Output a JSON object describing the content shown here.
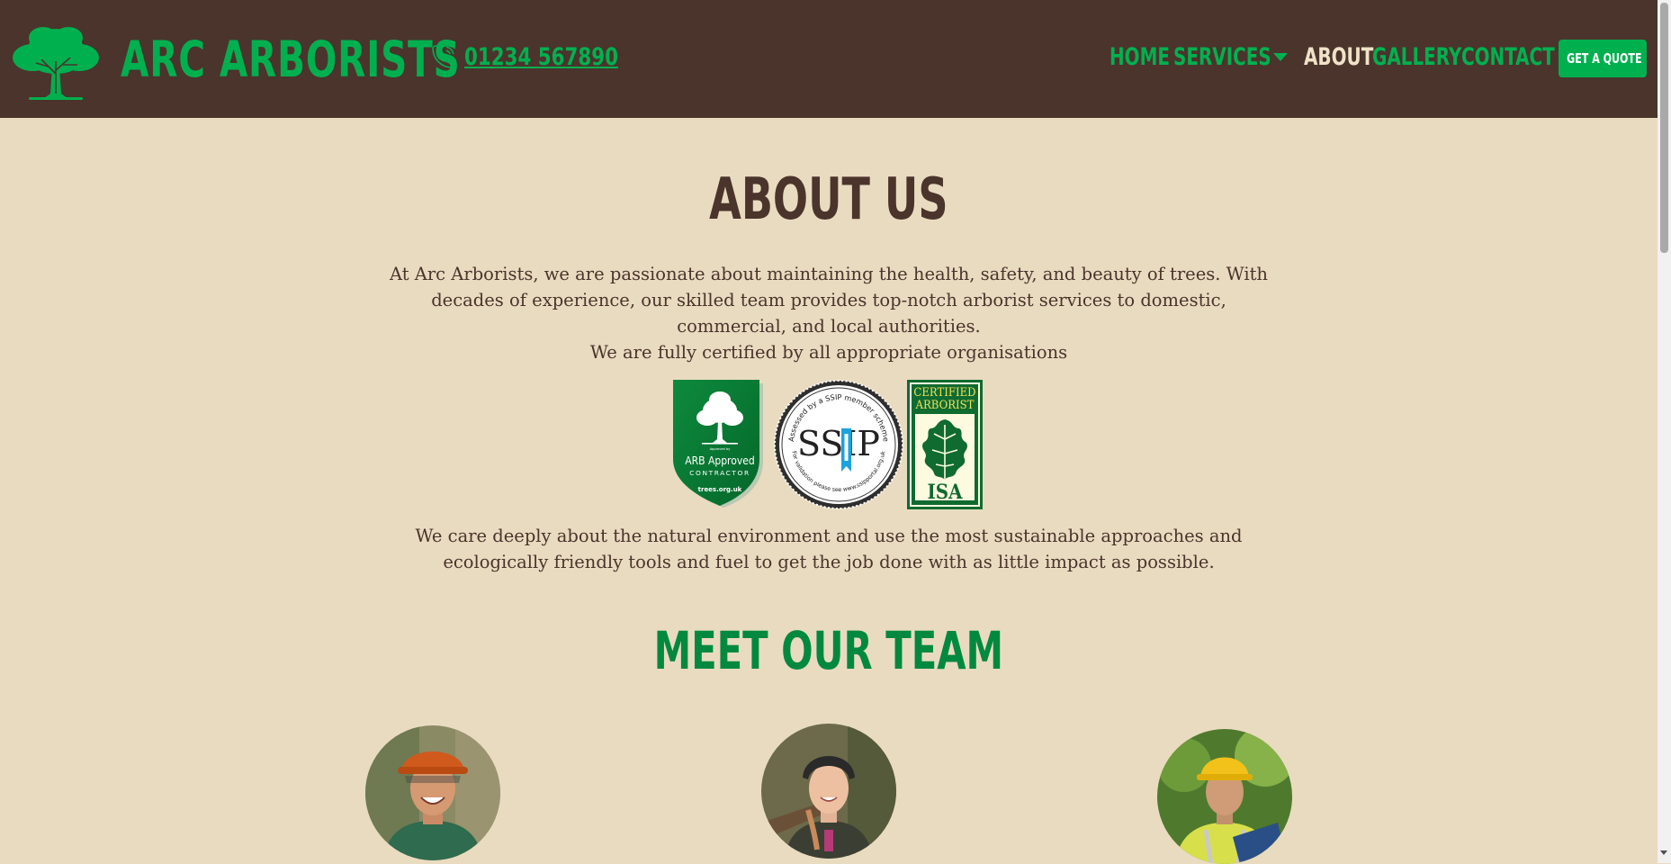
{
  "header": {
    "brand": "ARC ARBORISTS",
    "phone": "01234 567890",
    "nav": [
      {
        "label": "HOME",
        "active": false
      },
      {
        "label": "SERVICES",
        "active": false
      },
      {
        "label": "ABOUT",
        "active": true
      },
      {
        "label": "GALLERY",
        "active": false
      },
      {
        "label": "CONTACT",
        "active": false
      }
    ],
    "cta_label": "GET A QUOTE",
    "icons": {
      "logo": "tree-logo-icon",
      "phone": "phone-icon",
      "services_caret": "caret-down-icon"
    }
  },
  "about": {
    "title": "ABOUT US",
    "intro": "At Arc Arborists, we are passionate about maintaining the health, safety, and beauty of trees. With decades of experience, our skilled team provides top-notch arborist services to domestic, commercial, and local authorities.",
    "certified": "We are fully certified by all appropriate organisations",
    "badges": {
      "arb": {
        "tiny_top": "Approved by",
        "line1": "ARB Approved",
        "line2": "CONTRACTOR",
        "url": "trees.org.uk"
      },
      "ssip": {
        "center": "SSIP",
        "ring_top": "Assessed by a SSIP member scheme",
        "ring_bottom": "For validation please see www.ssipportal.org.uk"
      },
      "isa": {
        "line1": "CERTIFIED",
        "line2": "ARBORIST",
        "line3": "ISA"
      }
    },
    "environment": "We care deeply about the natural environment and use the most sustainable approaches and ecologically friendly tools and fuel to get the job done with as little impact as possible."
  },
  "team": {
    "title": "MEET OUR TEAM",
    "members": [
      {
        "photo": "team-member-photo-1"
      },
      {
        "photo": "team-member-photo-2"
      },
      {
        "photo": "team-member-photo-3"
      }
    ]
  },
  "colors": {
    "header_bg": "#4a342c",
    "page_bg": "#e9dbc0",
    "brand_green": "#00b04f",
    "heading_brown": "#4a342c",
    "team_heading_green": "#00893f",
    "nav_active": "#efe2c8"
  }
}
